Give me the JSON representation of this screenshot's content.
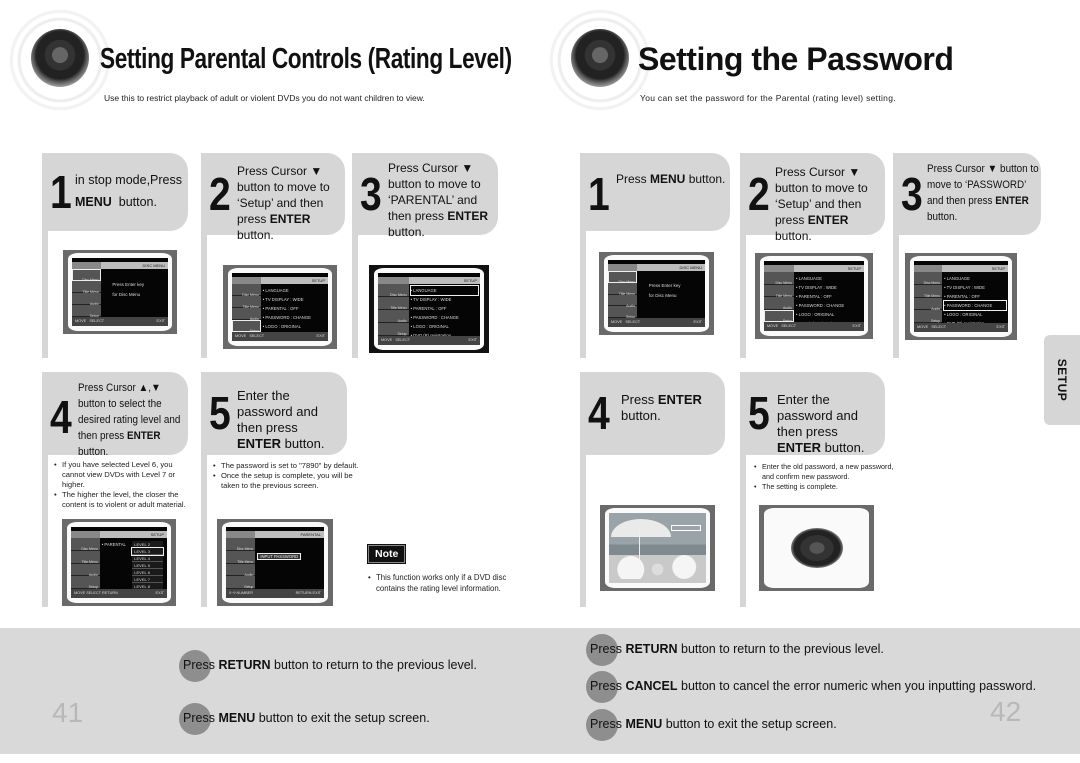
{
  "left_page": {
    "title": "Setting Parental Controls (Rating Level)",
    "subtitle": "Use this to restrict playback of adult or violent DVDs you do not want children to view.",
    "page_number": "41",
    "steps": [
      {
        "num": "1",
        "lines": [
          "in stop mode,Press"
        ],
        "bold": "MENU",
        "after": "  button."
      },
      {
        "num": "2",
        "pre": "Press Cursor ▼ button to move to ‘Setup’ and then press ",
        "bold": "ENTER",
        "after": " button."
      },
      {
        "num": "3",
        "pre": "Press Cursor ▼ button to move to ‘PARENTAL’ and then press ",
        "bold": "ENTER",
        "after": " button."
      },
      {
        "num": "4",
        "pre": "Press Cursor ▲,▼ button to select the desired rating level and then press ",
        "bold": "ENTER",
        "after": " button.",
        "bullets": [
          "If you have selected Level 6, you cannot view DVDs with Level 7 or higher.",
          "The higher the level, the closer the content is to violent or adult material."
        ]
      },
      {
        "num": "5",
        "pre": "Enter the password and then press ",
        "bold": "ENTER",
        "after": " button.",
        "bullets": [
          "The password is set to \"7890\" by default.",
          "Once the setup is complete, you will be taken to the previous screen."
        ]
      }
    ],
    "note": {
      "label": "Note",
      "bullets": [
        "This function works only if a DVD disc contains the rating level information."
      ]
    },
    "tips": [
      {
        "pre": "Press ",
        "bold": "RETURN",
        "after": " button to return to the previous level."
      },
      {
        "pre": "Press ",
        "bold": "MENU",
        "after": " button to exit the setup screen."
      }
    ]
  },
  "right_page": {
    "title": "Setting the Password",
    "subtitle": "You can set the password for the Parental (rating level) setting.",
    "page_number": "42",
    "side_tab": "SETUP",
    "steps": [
      {
        "num": "1",
        "pre": "Press ",
        "bold": "MENU",
        "after": " button."
      },
      {
        "num": "2",
        "pre": "Press Cursor ▼ button to move to ‘Setup’ and then press ",
        "bold": "ENTER",
        "after": " button."
      },
      {
        "num": "3",
        "pre": "Press Cursor ▼ button to move to ‘PASSWORD’ and then press ",
        "bold": "ENTER",
        "after": " button."
      },
      {
        "num": "4",
        "pre": "Press ",
        "bold": "ENTER",
        "after": " button."
      },
      {
        "num": "5",
        "pre": "Enter the password and then press ",
        "bold": "ENTER",
        "after": " button.",
        "bullets": [
          "Enter the old password, a new password, and confirm new password.",
          "The setting is complete."
        ]
      }
    ],
    "tips": [
      {
        "pre": "Press ",
        "bold": "RETURN",
        "after": " button to return to the previous level."
      },
      {
        "pre": "Press ",
        "bold": "CANCEL",
        "after": " button to cancel the error numeric when you inputting password."
      },
      {
        "pre": "Press ",
        "bold": "MENU",
        "after": " button to exit the setup screen."
      }
    ]
  },
  "screens": {
    "side_menu": [
      "Disc Menu",
      "Title Menu",
      "Audio",
      "Setup"
    ],
    "disc_menu": {
      "header_left": "DVD MENU",
      "header_right": "DISC MENU",
      "message": [
        "Press Enter key",
        "for Disc Menu"
      ],
      "footer": [
        "MOVE",
        "SELECT",
        "EXIT"
      ]
    },
    "setup_menu": {
      "header_left": "DVD MENU",
      "header_right": "SETUP",
      "items": [
        "• LANGUAGE",
        "• TV  DISPLAY   : WIDE",
        "• PARENTAL     : OFF",
        "• PASSWORD    : CHANGE",
        "• LOGO         : ORIGINAL",
        "• DVD (R) registration"
      ],
      "footer": [
        "MOVE",
        "SELECT",
        "EXIT"
      ]
    },
    "parental_menu": {
      "header_left": "DVD MENU",
      "header_right": "SETUP",
      "label": "• PARENTAL",
      "levels": [
        "LEVEL 2",
        "LEVEL 3",
        "LEVEL 4",
        "LEVEL 5",
        "LEVEL 6",
        "LEVEL 7",
        "LEVEL 8"
      ],
      "footer": [
        "MOVE",
        "SELECT",
        "RETURN",
        "EXIT"
      ]
    },
    "password_entry": {
      "header_left": "DVD MENU",
      "header_right": "PARENTAL",
      "field": "INPUT PASSWORD",
      "footer": [
        "0~9 NUMBER",
        "RETURN",
        "EXIT"
      ]
    }
  }
}
